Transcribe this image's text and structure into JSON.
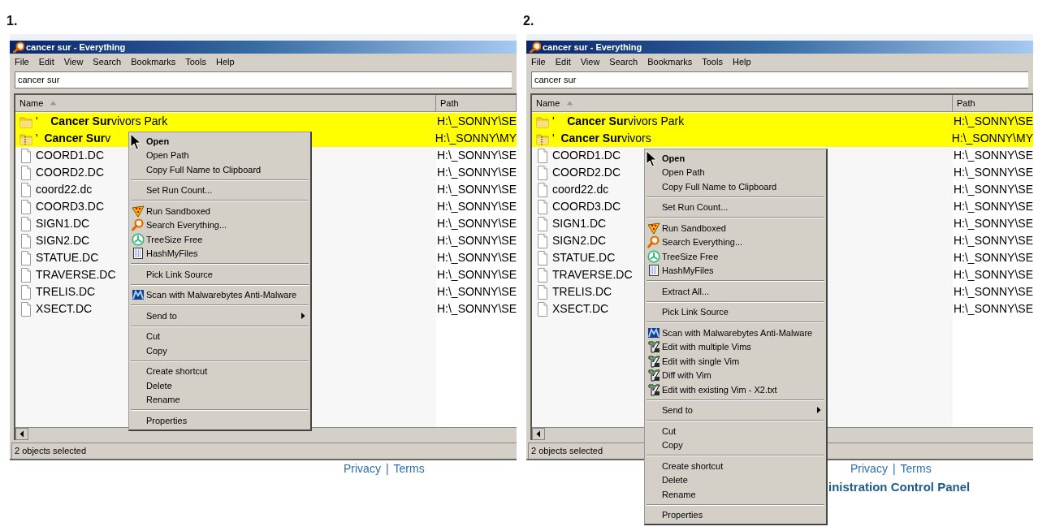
{
  "panels": [
    {
      "label": "1.",
      "window": {
        "title": "cancer sur - Everything",
        "menu_bar": [
          "File",
          "Edit",
          "View",
          "Search",
          "Bookmarks",
          "Tools",
          "Help"
        ],
        "search": {
          "value": "cancer sur"
        },
        "columns": [
          {
            "label": "Name",
            "sorted": true
          },
          {
            "label": "Path",
            "sorted": false
          }
        ],
        "rows": [
          {
            "kind": "folder",
            "name": "'    **Cancer Sur**vivors Park",
            "path": "H:\\_SONNY\\SE",
            "selected": true
          },
          {
            "kind": "zip",
            "name": "'  **Cancer Sur**v",
            "path": "H:\\_SONNY\\MY",
            "selected": true
          },
          {
            "kind": "file",
            "name": "COORD1.DC",
            "path": "H:\\_SONNY\\SE",
            "selected": false
          },
          {
            "kind": "file",
            "name": "COORD2.DC",
            "path": "H:\\_SONNY\\SE",
            "selected": false
          },
          {
            "kind": "file",
            "name": "coord22.dc",
            "path": "H:\\_SONNY\\SE",
            "selected": false
          },
          {
            "kind": "file",
            "name": "COORD3.DC",
            "path": "H:\\_SONNY\\SE",
            "selected": false
          },
          {
            "kind": "file",
            "name": "SIGN1.DC",
            "path": "H:\\_SONNY\\SE",
            "selected": false
          },
          {
            "kind": "file",
            "name": "SIGN2.DC",
            "path": "H:\\_SONNY\\SE",
            "selected": false
          },
          {
            "kind": "file",
            "name": "STATUE.DC",
            "path": "H:\\_SONNY\\SE",
            "selected": false
          },
          {
            "kind": "file",
            "name": "TRAVERSE.DC",
            "path": "H:\\_SONNY\\SE",
            "selected": false
          },
          {
            "kind": "file",
            "name": "TRELIS.DC",
            "path": "H:\\_SONNY\\SE",
            "selected": false
          },
          {
            "kind": "file",
            "name": "XSECT.DC",
            "path": "H:\\_SONNY\\SE",
            "selected": false
          }
        ],
        "status_bar": "2 objects selected"
      },
      "context_menu": {
        "items": [
          {
            "kind": "item",
            "label": "Open",
            "default": true
          },
          {
            "kind": "item",
            "label": "Open Path",
            "default": false
          },
          {
            "kind": "item",
            "label": "Copy Full Name to Clipboard",
            "default": false
          },
          {
            "kind": "separator"
          },
          {
            "kind": "item",
            "label": "Set Run Count...",
            "default": false
          },
          {
            "kind": "separator"
          },
          {
            "kind": "sandbox",
            "label": "Run Sandboxed",
            "default": false
          },
          {
            "kind": "search",
            "label": "Search Everything...",
            "default": false
          },
          {
            "kind": "treesize",
            "label": "TreeSize Free",
            "default": false
          },
          {
            "kind": "hash",
            "label": "HashMyFiles",
            "default": false
          },
          {
            "kind": "separator"
          },
          {
            "kind": "item",
            "label": "Pick Link Source",
            "default": false
          },
          {
            "kind": "separator"
          },
          {
            "kind": "malware",
            "label": "Scan with Malwarebytes Anti-Malware",
            "default": false
          },
          {
            "kind": "separator"
          },
          {
            "kind": "submenu",
            "label": "Send to"
          },
          {
            "kind": "separator"
          },
          {
            "kind": "item",
            "label": "Cut",
            "default": false
          },
          {
            "kind": "item",
            "label": "Copy",
            "default": false
          },
          {
            "kind": "separator"
          },
          {
            "kind": "item",
            "label": "Create shortcut",
            "default": false
          },
          {
            "kind": "item",
            "label": "Delete",
            "default": false
          },
          {
            "kind": "item",
            "label": "Rename",
            "default": false
          },
          {
            "kind": "separator"
          },
          {
            "kind": "item",
            "label": "Properties",
            "default": false
          }
        ]
      },
      "footer": {
        "links": [
          "Privacy",
          "Terms"
        ],
        "separator": "|"
      }
    },
    {
      "label": "2.",
      "window": {
        "title": "cancer sur - Everything",
        "menu_bar": [
          "File",
          "Edit",
          "View",
          "Search",
          "Bookmarks",
          "Tools",
          "Help"
        ],
        "search": {
          "value": "cancer sur"
        },
        "columns": [
          {
            "label": "Name",
            "sorted": true
          },
          {
            "label": "Path",
            "sorted": false
          }
        ],
        "rows": [
          {
            "kind": "folder",
            "name": "'    **Cancer Sur**vivors Park",
            "path": "H:\\_SONNY\\SE",
            "selected": true
          },
          {
            "kind": "zip",
            "name": "'  **Cancer Sur**vivors",
            "path": "H:\\_SONNY\\MY",
            "selected": true
          },
          {
            "kind": "file",
            "name": "COORD1.DC",
            "path": "H:\\_SONNY\\SE",
            "selected": false
          },
          {
            "kind": "file",
            "name": "COORD2.DC",
            "path": "H:\\_SONNY\\SE",
            "selected": false
          },
          {
            "kind": "file",
            "name": "coord22.dc",
            "path": "H:\\_SONNY\\SE",
            "selected": false
          },
          {
            "kind": "file",
            "name": "COORD3.DC",
            "path": "H:\\_SONNY\\SE",
            "selected": false
          },
          {
            "kind": "file",
            "name": "SIGN1.DC",
            "path": "H:\\_SONNY\\SE",
            "selected": false
          },
          {
            "kind": "file",
            "name": "SIGN2.DC",
            "path": "H:\\_SONNY\\SE",
            "selected": false
          },
          {
            "kind": "file",
            "name": "STATUE.DC",
            "path": "H:\\_SONNY\\SE",
            "selected": false
          },
          {
            "kind": "file",
            "name": "TRAVERSE.DC",
            "path": "H:\\_SONNY\\SE",
            "selected": false
          },
          {
            "kind": "file",
            "name": "TRELIS.DC",
            "path": "H:\\_SONNY\\SE",
            "selected": false
          },
          {
            "kind": "file",
            "name": "XSECT.DC",
            "path": "H:\\_SONNY\\SE",
            "selected": false
          }
        ],
        "status_bar": "2 objects selected"
      },
      "context_menu": {
        "items": [
          {
            "kind": "item",
            "label": "Open",
            "default": true
          },
          {
            "kind": "item",
            "label": "Open Path",
            "default": false
          },
          {
            "kind": "item",
            "label": "Copy Full Name to Clipboard",
            "default": false
          },
          {
            "kind": "separator"
          },
          {
            "kind": "item",
            "label": "Set Run Count...",
            "default": false
          },
          {
            "kind": "separator"
          },
          {
            "kind": "sandbox",
            "label": "Run Sandboxed",
            "default": false
          },
          {
            "kind": "search",
            "label": "Search Everything...",
            "default": false
          },
          {
            "kind": "treesize",
            "label": "TreeSize Free",
            "default": false
          },
          {
            "kind": "hash",
            "label": "HashMyFiles",
            "default": false
          },
          {
            "kind": "separator"
          },
          {
            "kind": "item",
            "label": "Extract All...",
            "default": false
          },
          {
            "kind": "separator"
          },
          {
            "kind": "item",
            "label": "Pick Link Source",
            "default": false
          },
          {
            "kind": "separator"
          },
          {
            "kind": "malware",
            "label": "Scan with Malwarebytes Anti-Malware",
            "default": false
          },
          {
            "kind": "vim",
            "label": "Edit with multiple Vims",
            "default": false
          },
          {
            "kind": "vim",
            "label": "Edit with single Vim",
            "default": false
          },
          {
            "kind": "vim",
            "label": "Diff with Vim",
            "default": false
          },
          {
            "kind": "vim",
            "label": "Edit with existing Vim - X2.txt",
            "default": false
          },
          {
            "kind": "separator"
          },
          {
            "kind": "submenu",
            "label": "Send to"
          },
          {
            "kind": "separator"
          },
          {
            "kind": "item",
            "label": "Cut",
            "default": false
          },
          {
            "kind": "item",
            "label": "Copy",
            "default": false
          },
          {
            "kind": "separator"
          },
          {
            "kind": "item",
            "label": "Create shortcut",
            "default": false
          },
          {
            "kind": "item",
            "label": "Delete",
            "default": false
          },
          {
            "kind": "item",
            "label": "Rename",
            "default": false
          },
          {
            "kind": "separator"
          },
          {
            "kind": "item",
            "label": "Properties",
            "default": false
          }
        ]
      },
      "footer": {
        "links": [
          "Privacy",
          "Terms"
        ],
        "separator": "|",
        "heading": "inistration Control Panel"
      }
    }
  ]
}
